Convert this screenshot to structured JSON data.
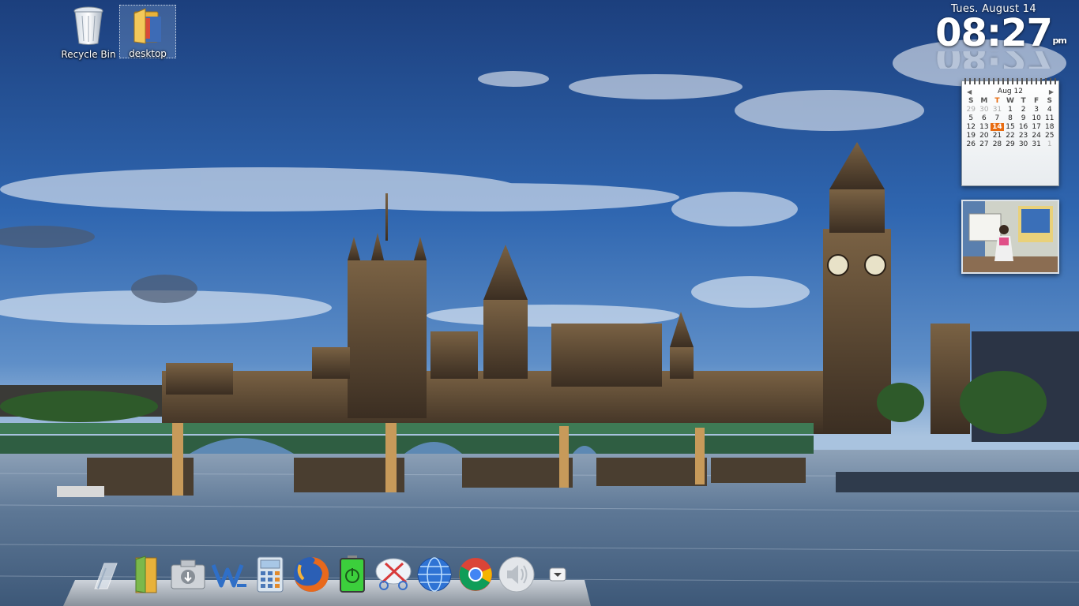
{
  "desktop": {
    "icons": [
      {
        "label": "Recycle Bin",
        "icon": "recycle-bin-icon"
      },
      {
        "label": "desktop",
        "icon": "folder-icon"
      }
    ]
  },
  "clock": {
    "date": "Tues. August 14",
    "time": "08:27",
    "ampm": "pm"
  },
  "calendar": {
    "month_label": "Aug 12",
    "day_names": [
      "S",
      "M",
      "T",
      "W",
      "T",
      "F",
      "S"
    ],
    "weeks": [
      [
        "29",
        "30",
        "31",
        "1",
        "2",
        "3",
        "4"
      ],
      [
        "5",
        "6",
        "7",
        "8",
        "9",
        "10",
        "11"
      ],
      [
        "12",
        "13",
        "14",
        "15",
        "16",
        "17",
        "18"
      ],
      [
        "19",
        "20",
        "21",
        "22",
        "23",
        "24",
        "25"
      ],
      [
        "26",
        "27",
        "28",
        "29",
        "30",
        "31",
        "1"
      ]
    ],
    "today": "14"
  },
  "dock": {
    "items": [
      {
        "icon": "show-desktop-icon"
      },
      {
        "icon": "file-manager-icon"
      },
      {
        "icon": "download-drive-icon"
      },
      {
        "icon": "office-writer-icon"
      },
      {
        "icon": "calculator-icon"
      },
      {
        "icon": "firefox-icon"
      },
      {
        "icon": "power-battery-icon"
      },
      {
        "icon": "snipping-tool-icon"
      },
      {
        "icon": "network-globe-icon"
      },
      {
        "icon": "chrome-icon"
      },
      {
        "icon": "volume-icon"
      },
      {
        "icon": "dock-menu-arrow-icon"
      }
    ]
  },
  "colors": {
    "sky": "#2a5fa8",
    "accent_today": "#e86b10",
    "bridge_green": "#3e7a55",
    "river": "#6f86a3"
  }
}
